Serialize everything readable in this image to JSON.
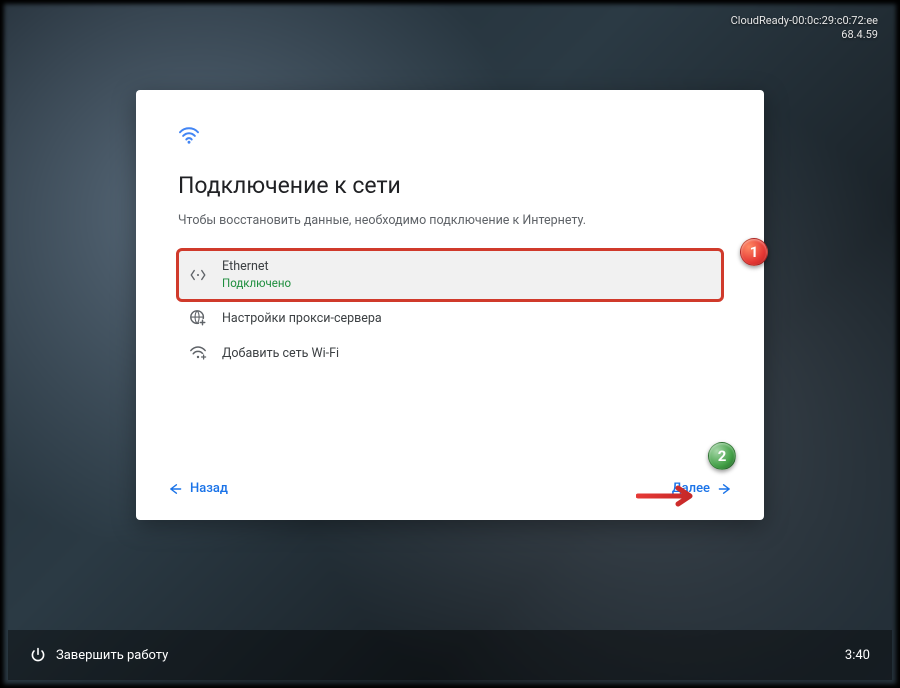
{
  "system": {
    "hostname": "CloudReady-00:0c:29:c0:72:ee",
    "version": "68.4.59"
  },
  "card": {
    "title": "Подключение к сети",
    "subtitle": "Чтобы восстановить данные, необходимо подключение к Интернету.",
    "items": {
      "ethernet": {
        "label": "Ethernet",
        "status": "Подключено"
      },
      "proxy": {
        "label": "Настройки прокси-сервера"
      },
      "addwifi": {
        "label": "Добавить сеть Wi-Fi"
      }
    },
    "nav": {
      "back": "Назад",
      "next": "Далее"
    }
  },
  "taskbar": {
    "shutdown": "Завершить работу",
    "clock": "3:40"
  },
  "annotations": {
    "badge1": "1",
    "badge2": "2"
  },
  "colors": {
    "accent": "#1a73e8",
    "connected": "#1e8e3e",
    "highlight_outline": "#d03a2b"
  }
}
